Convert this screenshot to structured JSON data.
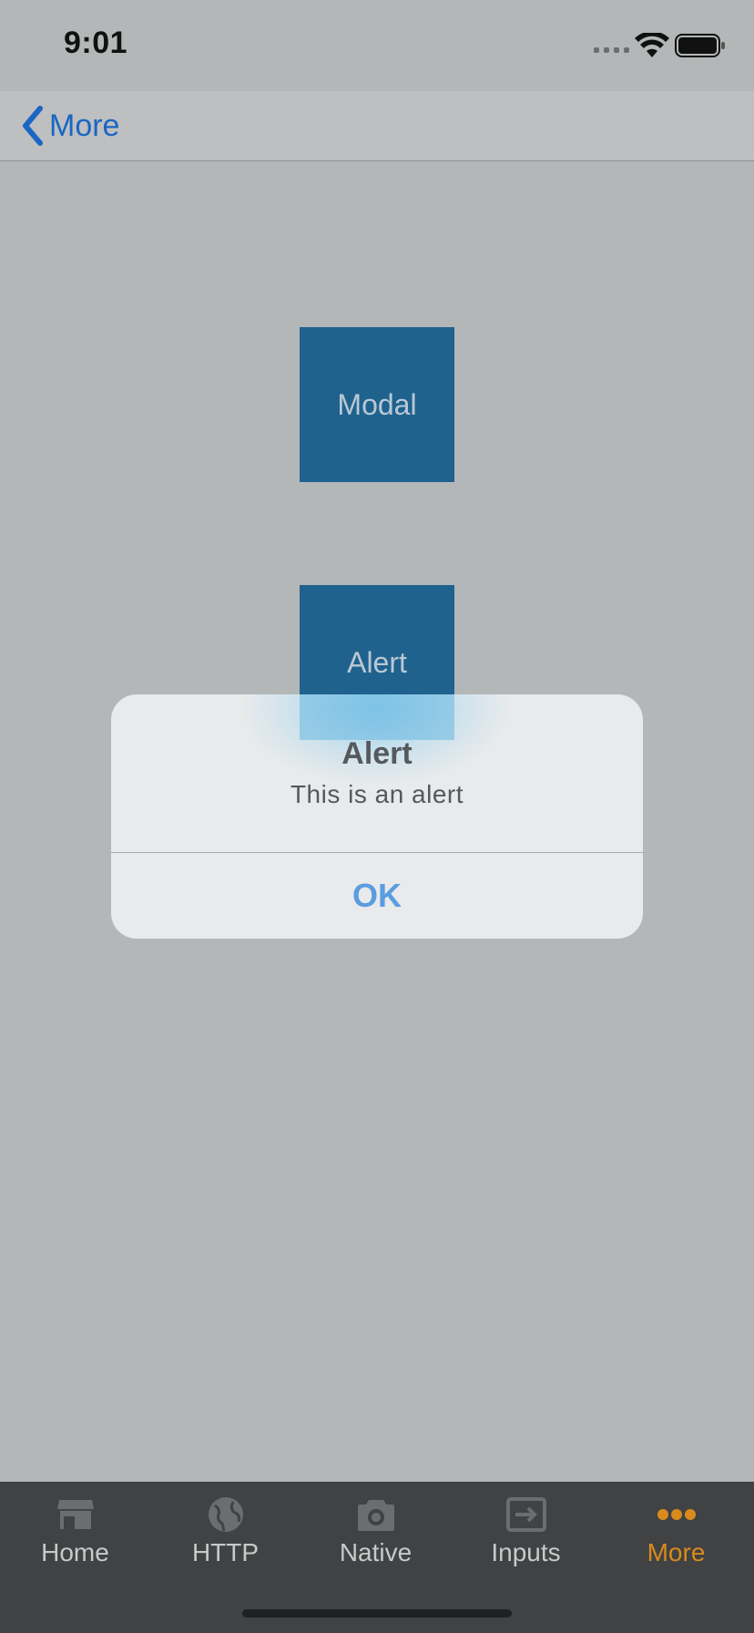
{
  "status_bar": {
    "time": "9:01"
  },
  "nav": {
    "back_label": "More"
  },
  "content": {
    "modal_button": "Modal",
    "alert_button": "Alert"
  },
  "alert": {
    "title": "Alert",
    "message": "This is an alert",
    "ok": "OK"
  },
  "tabs": [
    {
      "label": "Home",
      "icon": "store-icon",
      "active": false
    },
    {
      "label": "HTTP",
      "icon": "globe-icon",
      "active": false
    },
    {
      "label": "Native",
      "icon": "camera-icon",
      "active": false
    },
    {
      "label": "Inputs",
      "icon": "input-icon",
      "active": false
    },
    {
      "label": "More",
      "icon": "more-icon",
      "active": true
    }
  ],
  "colors": {
    "accent_blue": "#1a66c2",
    "active_tab": "#d98a1c",
    "square_blue": "#1f628e"
  }
}
